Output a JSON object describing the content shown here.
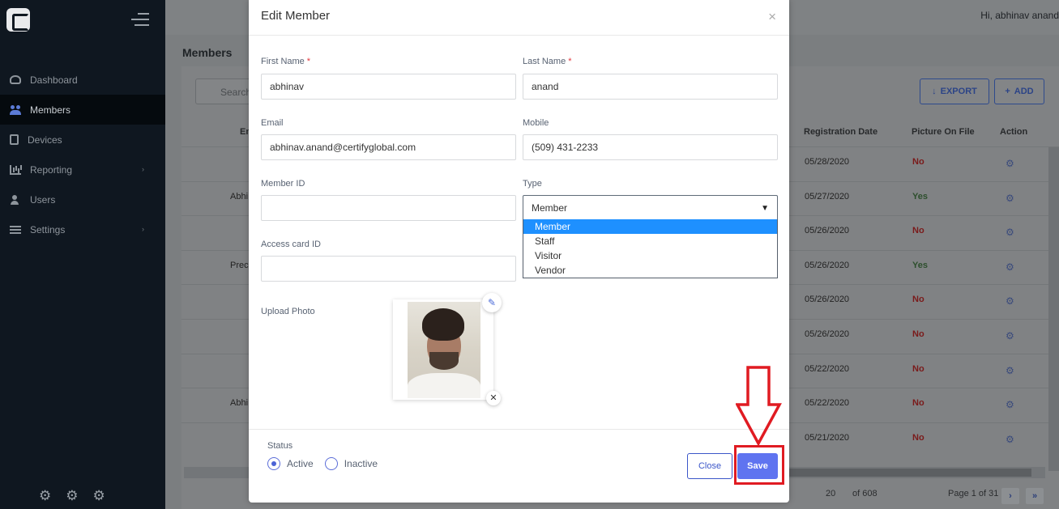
{
  "sidebar": {
    "items": [
      {
        "label": "Dashboard",
        "icon": "dashboard-icon"
      },
      {
        "label": "Members",
        "icon": "members-icon"
      },
      {
        "label": "Devices",
        "icon": "devices-icon"
      },
      {
        "label": "Reporting",
        "icon": "reporting-icon"
      },
      {
        "label": "Users",
        "icon": "users-icon"
      },
      {
        "label": "Settings",
        "icon": "settings-icon"
      }
    ],
    "chevron": "›",
    "footer_icons": [
      "user-settings-icon",
      "gears-icon",
      "gear-icon"
    ]
  },
  "header": {
    "greeting": "Hi,  abhinav anand"
  },
  "page": {
    "title": "Members",
    "search_placeholder": "Search",
    "export_label": "EXPORT",
    "add_label": "ADD",
    "columns": [
      "Em",
      "Registration Date",
      "Picture On File",
      "Action"
    ],
    "rows": [
      {
        "left": "",
        "date": "05/28/2020",
        "picture": "No"
      },
      {
        "left": "Abhi",
        "date": "05/27/2020",
        "picture": "Yes"
      },
      {
        "left": "",
        "date": "05/26/2020",
        "picture": "No"
      },
      {
        "left": "Prec",
        "date": "05/26/2020",
        "picture": "Yes"
      },
      {
        "left": "",
        "date": "05/26/2020",
        "picture": "No"
      },
      {
        "left": "",
        "date": "05/26/2020",
        "picture": "No"
      },
      {
        "left": "",
        "date": "05/22/2020",
        "picture": "No"
      },
      {
        "left": "Abhi",
        "date": "05/22/2020",
        "picture": "No"
      },
      {
        "left": "",
        "date": "05/21/2020",
        "picture": "No"
      }
    ],
    "pager": {
      "page_size": "20",
      "of_total": "of 608",
      "page_info": "Page 1 of 31"
    }
  },
  "modal": {
    "title": "Edit Member",
    "close_x": "×",
    "first_name_label": "First Name",
    "first_name_value": "abhinav",
    "last_name_label": "Last Name",
    "last_name_value": "anand",
    "required_mark": "*",
    "email_label": "Email",
    "email_value": "abhinav.anand@certifyglobal.com",
    "mobile_label": "Mobile",
    "mobile_value": "(509) 431-2233",
    "member_id_label": "Member ID",
    "member_id_value": "",
    "type_label": "Type",
    "type_value": "Member",
    "type_options": [
      "Member",
      "Staff",
      "Visitor",
      "Vendor"
    ],
    "access_card_label": "Access card ID",
    "access_card_value": "",
    "upload_photo_label": "Upload Photo",
    "status_label": "Status",
    "status_options": [
      "Active",
      "Inactive"
    ],
    "status_selected": "Active",
    "close_button": "Close",
    "save_button": "Save"
  },
  "colors": {
    "sidebar_bg": "#0f1720",
    "accent": "#5f74f0",
    "annotation_red": "#e01b22",
    "dropdown_selected": "#1e90ff"
  }
}
